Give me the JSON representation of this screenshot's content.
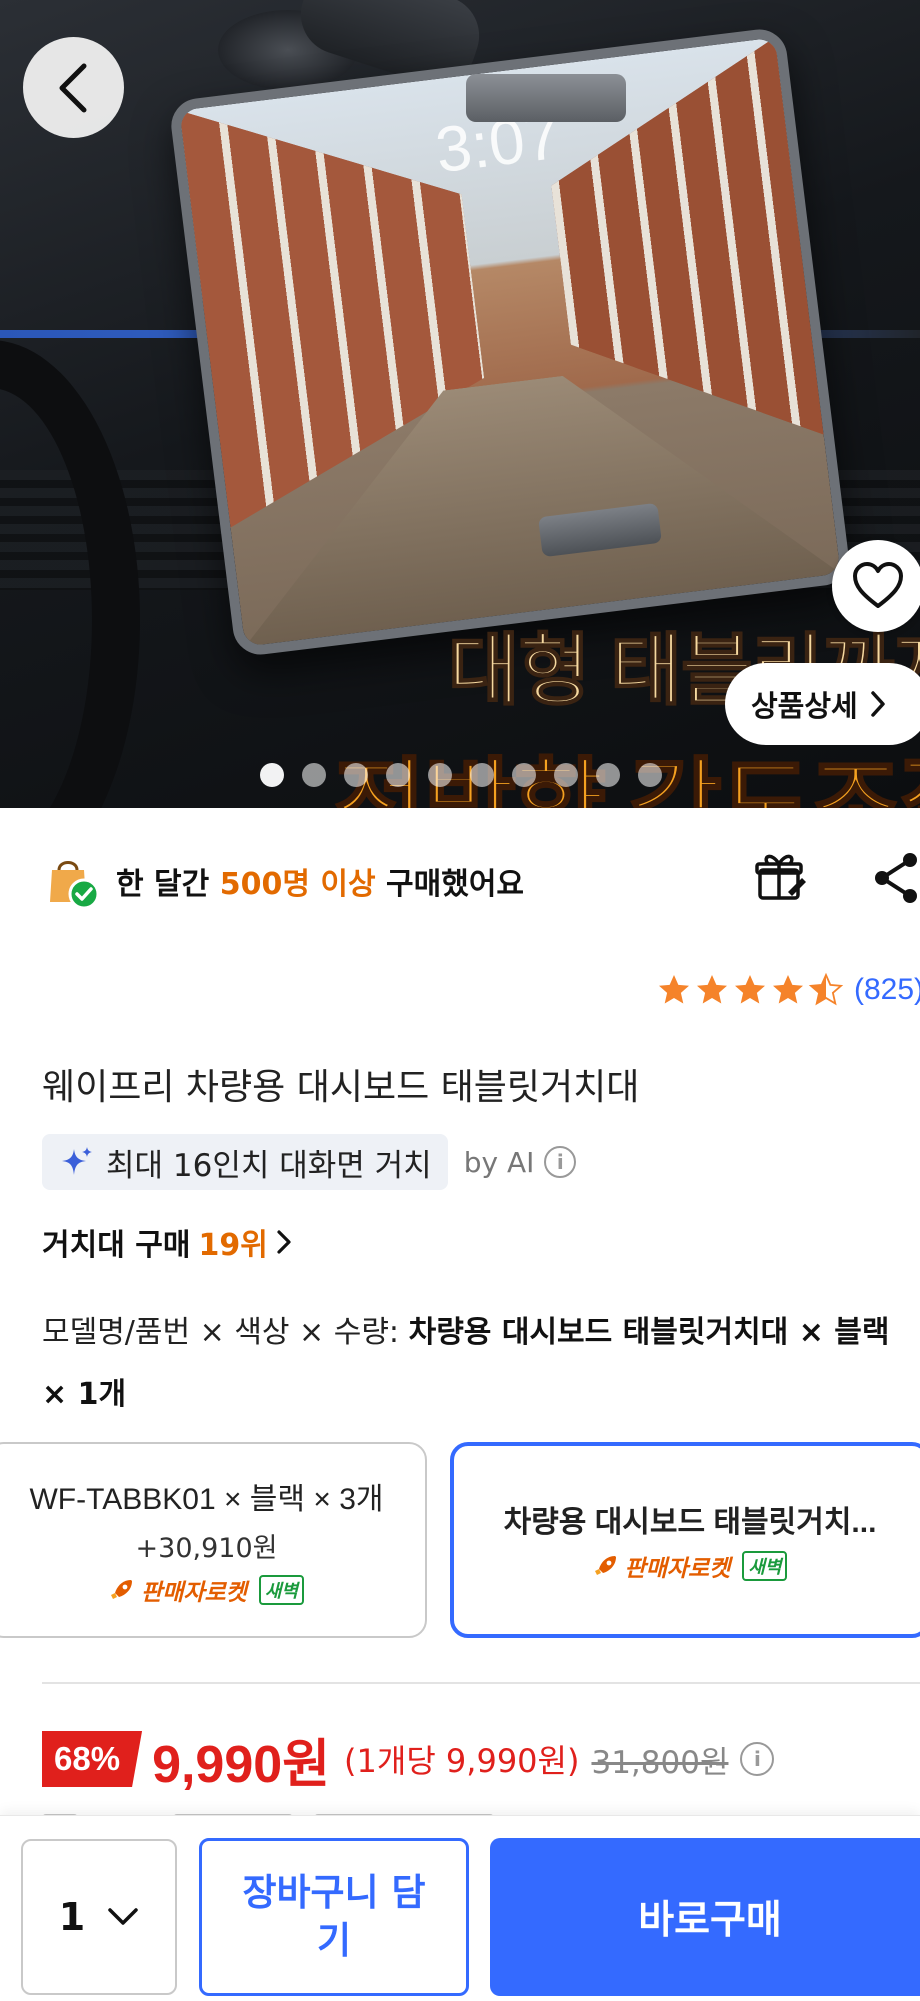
{
  "hero": {
    "clock_text": "3:07",
    "headline_1": "대형 태블리까지",
    "headline_2": "전방향 각도조절",
    "detail_button_label": "상품상세",
    "slide_count": 10,
    "active_slide": 1
  },
  "purchase_stats": {
    "prefix": "한 달간",
    "highlight": "500명 이상",
    "suffix": "구매했어요"
  },
  "rating": {
    "stars": 4.5,
    "count_label": "(825)"
  },
  "product": {
    "title": "웨이프리 차량용 대시보드 태블릿거치대"
  },
  "ai_summary": {
    "chip_text": "최대 16인치 대화면 거치",
    "by_label": "by AI"
  },
  "ranking": {
    "category_label": "거치대 구매",
    "rank_label": "19위"
  },
  "option_description": {
    "label": "모델명/품번 × 색상 × 수량:",
    "value": "차량용 대시보드 태블릿거치대 × 블랙 × 1개"
  },
  "options": [
    {
      "name": "WF-TABBK01 × 블랙 × 3개",
      "price_delta": "+30,910원",
      "delivery": "판매자로켓",
      "badge": "새벽",
      "selected": false
    },
    {
      "name": "차량용 대시보드 태블릿거치...",
      "delivery": "판매자로켓",
      "badge": "새벽",
      "selected": true
    }
  ],
  "price": {
    "discount": "68%",
    "sale_price": "9,990원",
    "unit_price": "(1개당 9,990원)",
    "original_price": "31,800원"
  },
  "bottom_bar": {
    "quantity": "1",
    "cart_button_label": "장바구니 담기",
    "buy_button_label": "바로구매"
  },
  "colors": {
    "accent_blue": "#346aff",
    "sale_red": "#e0201c",
    "highlight_orange": "#e26a00",
    "star_orange": "#f5832a"
  }
}
